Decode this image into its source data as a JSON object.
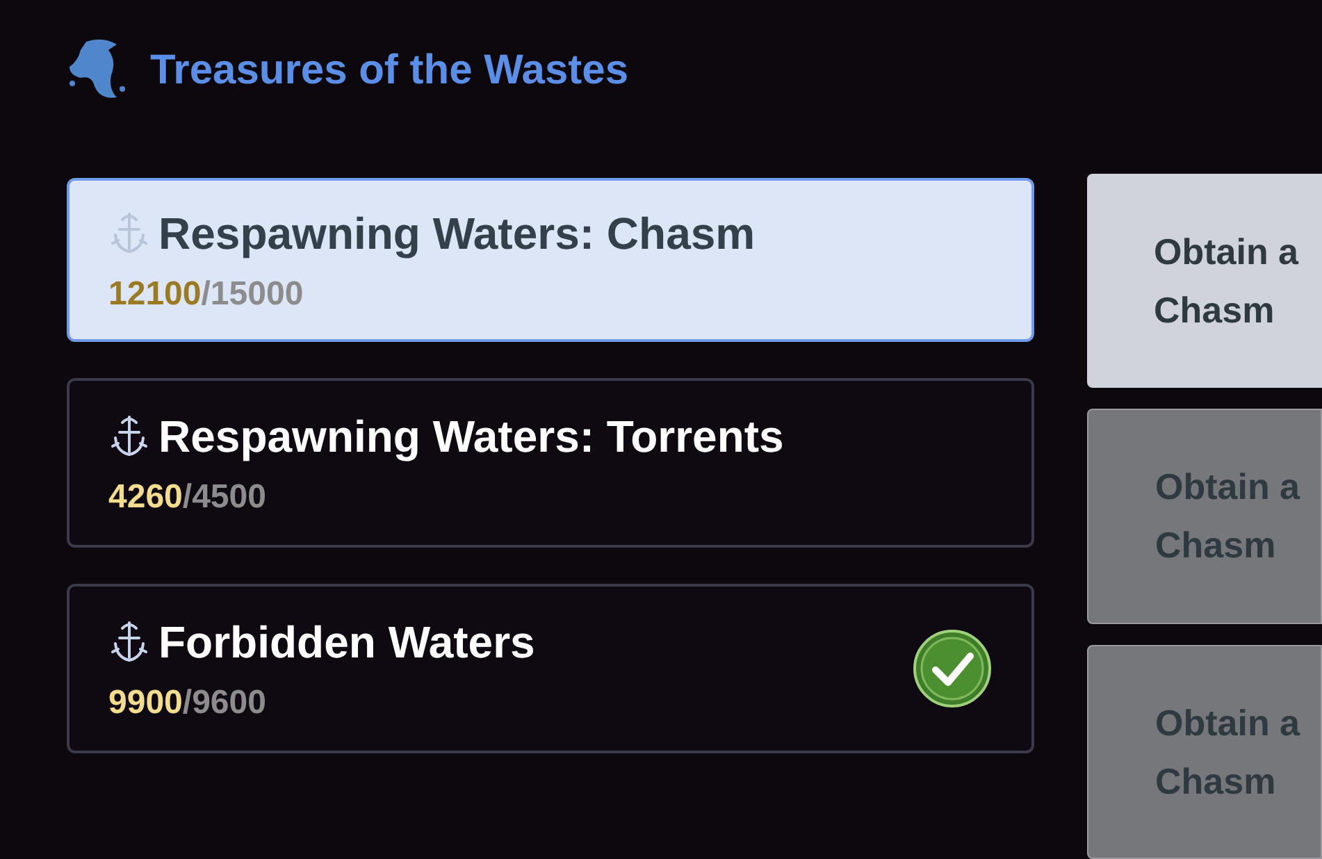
{
  "header": {
    "title": "Treasures of the Wastes"
  },
  "quests": [
    {
      "name": "Respawning Waters: Chasm",
      "current": "12100",
      "separator": "/",
      "required": "15000",
      "selected": true,
      "completed": false
    },
    {
      "name": "Respawning Waters: Torrents",
      "current": "4260",
      "separator": "/",
      "required": "4500",
      "selected": false,
      "completed": false
    },
    {
      "name": "Forbidden Waters",
      "current": "9900",
      "separator": "/",
      "required": "9600",
      "selected": false,
      "completed": true
    }
  ],
  "objectives": [
    {
      "label": "Obtain a Chasm",
      "selected": true
    },
    {
      "label": "Obtain a Chasm",
      "selected": false
    },
    {
      "label": "Obtain a Chasm",
      "selected": false
    }
  ]
}
